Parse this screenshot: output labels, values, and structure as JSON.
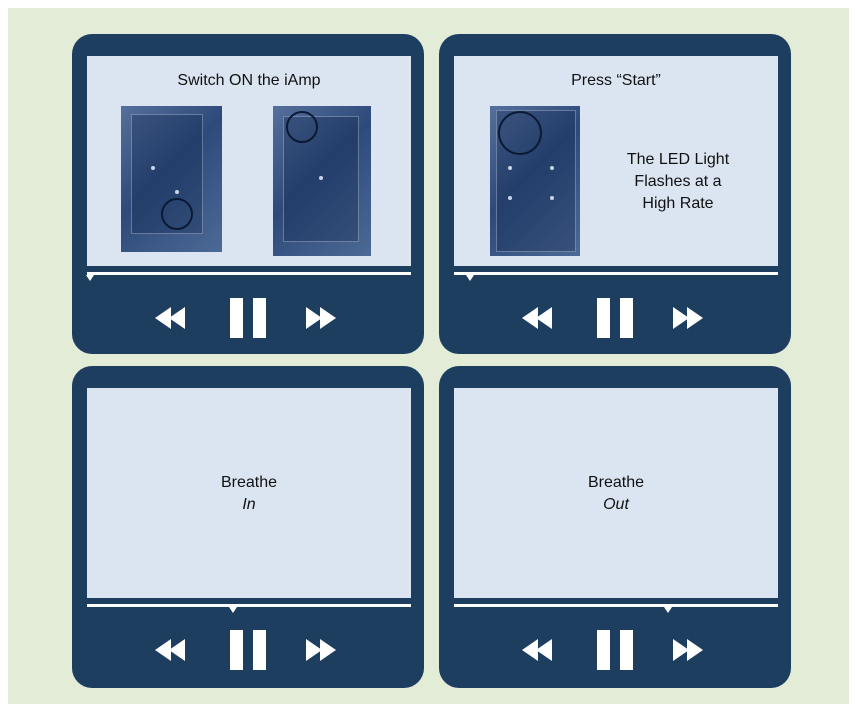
{
  "theme": {
    "background": "#e2ecd7",
    "player": "#1e3e60",
    "screen": "#dbe5f1",
    "photo_tint": "#3a5a8c"
  },
  "players": [
    {
      "title": "Switch ON the iAmp",
      "progress": 0.01,
      "controls": {
        "rewind": "rewind-icon",
        "pause": "pause-icon",
        "forward": "fast-forward-icon"
      }
    },
    {
      "title": "Press “Start”",
      "side_text_lines": [
        "The LED Light",
        "Flashes at a",
        "High Rate"
      ],
      "progress": 0.05,
      "controls": {
        "rewind": "rewind-icon",
        "pause": "pause-icon",
        "forward": "fast-forward-icon"
      }
    },
    {
      "line1": "Breathe",
      "line2": "In",
      "progress": 0.45,
      "controls": {
        "rewind": "rewind-icon",
        "pause": "pause-icon",
        "forward": "fast-forward-icon"
      }
    },
    {
      "line1": "Breathe",
      "line2": "Out",
      "progress": 0.66,
      "controls": {
        "rewind": "rewind-icon",
        "pause": "pause-icon",
        "forward": "fast-forward-icon"
      }
    }
  ]
}
